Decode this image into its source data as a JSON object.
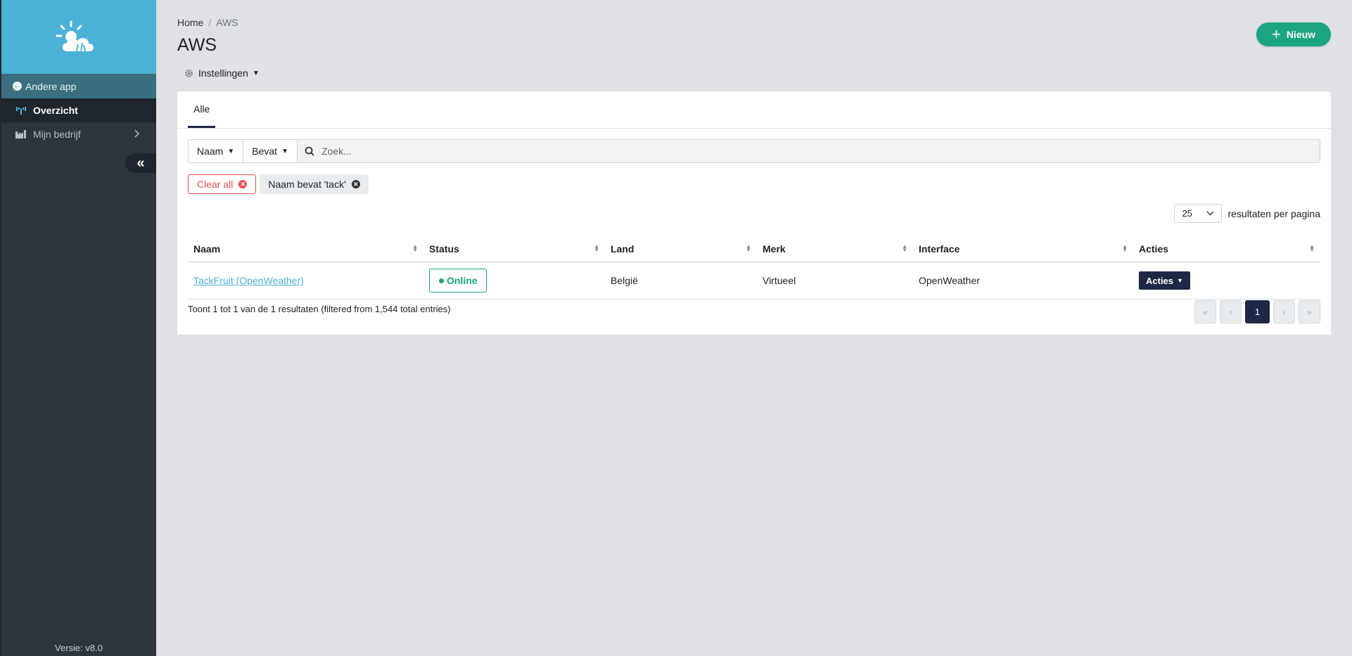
{
  "sidebar": {
    "back_label": "Andere app",
    "items": [
      {
        "label": "Overzicht",
        "icon": "antenna-icon",
        "active": true
      },
      {
        "label": "Mijn bedrijf",
        "icon": "factory-icon",
        "active": false
      }
    ],
    "collapse_icon": "double-chevron-left-icon",
    "version": "Versie: v8.0"
  },
  "header": {
    "breadcrumb": [
      "Home",
      "AWS"
    ],
    "title": "AWS",
    "settings_label": "Instellingen",
    "new_label": "Nieuw"
  },
  "tabs": [
    {
      "label": "Alle",
      "active": true
    }
  ],
  "filter": {
    "field": "Naam",
    "operator": "Bevat",
    "placeholder": "Zoek..."
  },
  "chips": {
    "clear_label": "Clear all",
    "active_filter": "Naam bevat 'tack'"
  },
  "per_page": {
    "value": "25",
    "label": "resultaten per pagina"
  },
  "table": {
    "columns": [
      "Naam",
      "Status",
      "Land",
      "Merk",
      "Interface",
      "Acties"
    ],
    "rows": [
      {
        "naam": "TackFruit (OpenWeather)",
        "status": "Online",
        "land": "België",
        "merk": "Virtueel",
        "interface": "OpenWeather",
        "acties": "Acties"
      }
    ]
  },
  "summary": "Toont 1 tot 1 van de 1 resultaten (filtered from 1,544 total entries)",
  "pagination": {
    "first": "«",
    "prev": "‹",
    "current": "1",
    "next": "›",
    "last": "»"
  },
  "colors": {
    "primary": "#1aa580",
    "brand": "#4bb1d6",
    "dark": "#1f2746",
    "danger": "#e7514f"
  }
}
